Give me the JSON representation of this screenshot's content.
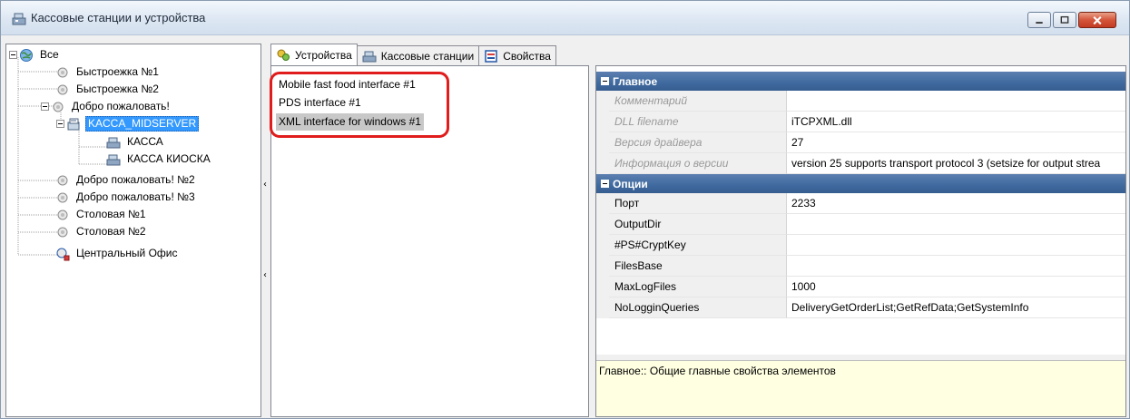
{
  "window": {
    "title": "Кассовые станции и устройства",
    "icon": "cash-register-icon"
  },
  "tree": {
    "root": "Все",
    "items": [
      {
        "label": "Быстроежка №1",
        "icon": "node-icon"
      },
      {
        "label": "Быстроежка №2",
        "icon": "node-icon"
      },
      {
        "label": "Добро пожаловать!",
        "icon": "node-icon"
      },
      {
        "label": "KACCA_MIDSERVER",
        "icon": "server-icon",
        "selected": true
      },
      {
        "label": "КАССА",
        "icon": "cash-register-icon"
      },
      {
        "label": "КАССА КИОСКА",
        "icon": "cash-register-icon"
      },
      {
        "label": "Добро пожаловать! №2",
        "icon": "node-icon"
      },
      {
        "label": "Добро пожаловать! №3",
        "icon": "node-icon"
      },
      {
        "label": "Столовая №1",
        "icon": "node-icon"
      },
      {
        "label": "Столовая №2",
        "icon": "node-icon"
      },
      {
        "label": "Центральный Офис",
        "icon": "office-icon"
      }
    ]
  },
  "tabs": [
    {
      "label": "Устройства",
      "icon": "devices-icon",
      "active": true
    },
    {
      "label": "Кассовые станции",
      "icon": "cash-register-icon",
      "active": false
    },
    {
      "label": "Свойства",
      "icon": "properties-icon",
      "active": false
    }
  ],
  "devices": [
    {
      "label": "Mobile fast food interface #1"
    },
    {
      "label": "PDS interface #1"
    },
    {
      "label": "XML interface for windows #1",
      "selected": true
    }
  ],
  "properties": {
    "categories": [
      {
        "name": "Главное",
        "rows": [
          {
            "name": "Комментарий",
            "value": "",
            "readonly": true
          },
          {
            "name": "DLL filename",
            "value": "iTCPXML.dll",
            "readonly": true
          },
          {
            "name": "Версия драйвера",
            "value": "27",
            "readonly": true
          },
          {
            "name": "Информация о версии",
            "value": "version 25 supports transport protocol 3 (setsize for output strea",
            "readonly": true
          }
        ]
      },
      {
        "name": "Опции",
        "rows": [
          {
            "name": "Порт",
            "value": "2233",
            "readonly": false
          },
          {
            "name": "OutputDir",
            "value": "",
            "readonly": false
          },
          {
            "name": "#PS#CryptKey",
            "value": "",
            "readonly": false
          },
          {
            "name": "FilesBase",
            "value": "",
            "readonly": false
          },
          {
            "name": "MaxLogFiles",
            "value": "1000",
            "readonly": false
          },
          {
            "name": "NoLogginQueries",
            "value": "DeliveryGetOrderList;GetRefData;GetSystemInfo",
            "readonly": false
          }
        ]
      }
    ],
    "description": "Главное:: Общие главные свойства элементов"
  },
  "colors": {
    "selection": "#3399ff",
    "category_header": "#3f6a9f",
    "description_bg": "#ffffe1",
    "highlight_ring": "#e01c1c"
  }
}
